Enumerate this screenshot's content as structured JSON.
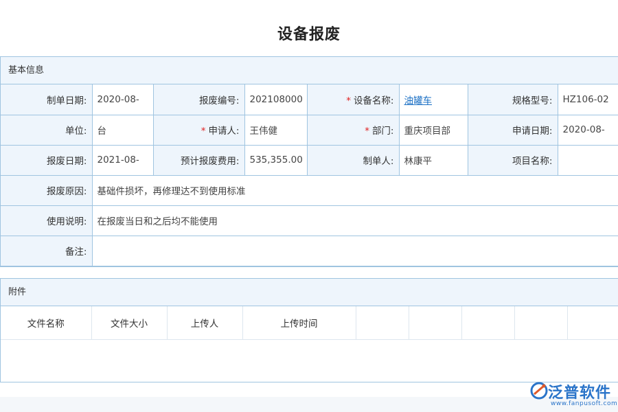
{
  "page": {
    "title": "设备报废"
  },
  "basic": {
    "section_title": "基本信息",
    "rows": [
      [
        {
          "label": "制单日期:",
          "value": "2020-08-"
        },
        {
          "label": "报废编号:",
          "value": "202108000"
        },
        {
          "label": "设备名称:",
          "value": "油罐车",
          "required": true
        },
        {
          "label": "规格型号:",
          "value": "HZ106-02"
        }
      ],
      [
        {
          "label": "单位:",
          "value": "台"
        },
        {
          "label": "申请人:",
          "value": "王伟健",
          "required": true
        },
        {
          "label": "部门:",
          "value": "重庆项目部",
          "required": true
        },
        {
          "label": "申请日期:",
          "value": "2020-08-"
        }
      ],
      [
        {
          "label": "报废日期:",
          "value": "2021-08-"
        },
        {
          "label": "预计报废费用:",
          "value": "535,355.00"
        },
        {
          "label": "制单人:",
          "value": "林康平"
        },
        {
          "label": "项目名称:",
          "value": ""
        }
      ]
    ],
    "reason": {
      "label": "报废原因:",
      "value": "基础件损坏，再修理达不到使用标准"
    },
    "usage": {
      "label": "使用说明:",
      "value": "在报废当日和之后均不能使用"
    },
    "remark": {
      "label": "备注:",
      "value": ""
    }
  },
  "attachments": {
    "section_title": "附件",
    "columns": [
      "文件名称",
      "文件大小",
      "上传人",
      "上传时间",
      "",
      "",
      "",
      ""
    ]
  },
  "logo": {
    "text": "泛普软件",
    "url": "www.fanpusoft.com"
  },
  "colors": {
    "border": "#9fc4e0",
    "label_bg": "#eef5fc",
    "required": "#e02020",
    "link": "#1a6fc4",
    "brand": "#2a74c9"
  }
}
